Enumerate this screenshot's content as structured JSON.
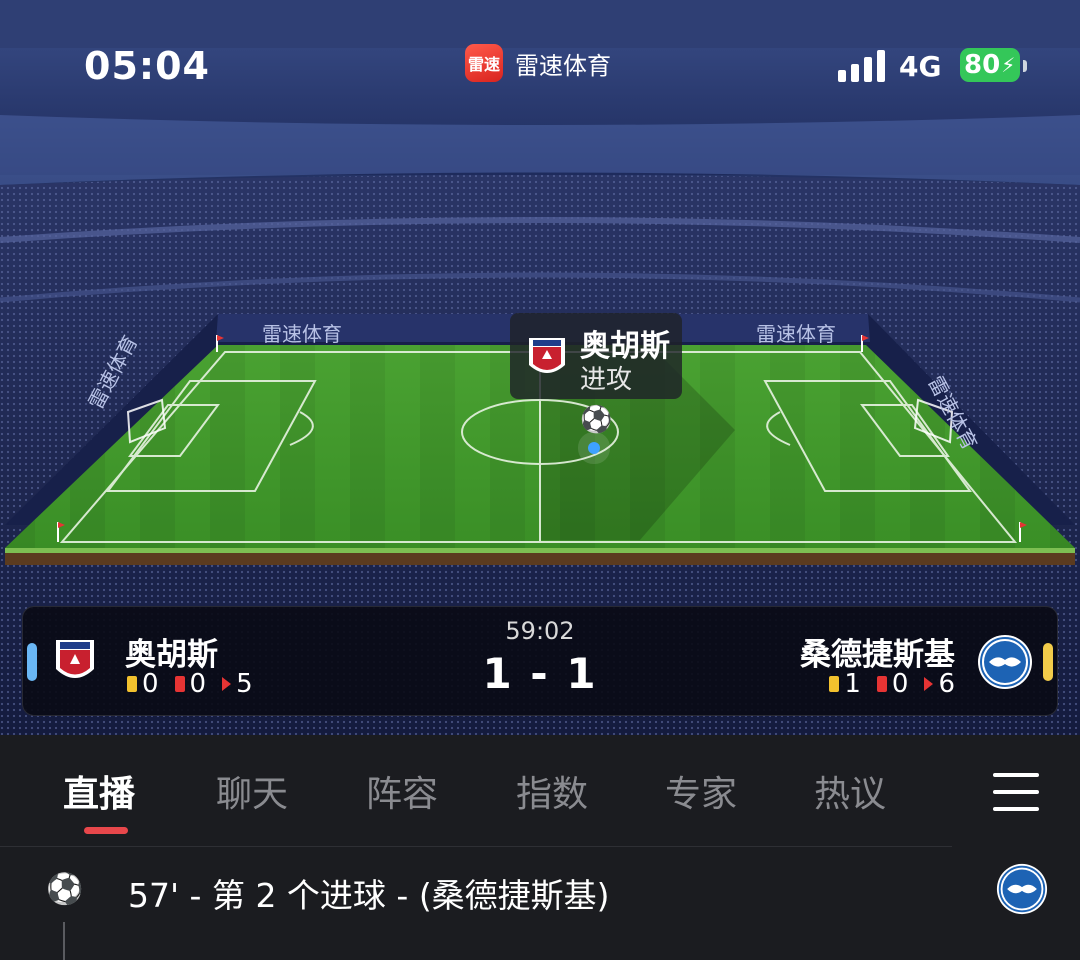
{
  "status_bar": {
    "time": "05:04",
    "app_logo_text": "雷速",
    "app_name": "雷速体育",
    "network": "4G",
    "battery": "80",
    "battery_color": "#34c759"
  },
  "pitch_ads": {
    "left": "雷速体育",
    "top_left": "雷速体育",
    "top_right": "雷速体育",
    "right": "雷速体育"
  },
  "event_popup": {
    "team": "奥胡斯",
    "action": "进攻",
    "badge_icon": "aarhus-crest-icon"
  },
  "scoreboard": {
    "clock": "59:02",
    "score": "1 - 1",
    "home": {
      "name": "奥胡斯",
      "yellow_cards": "0",
      "red_cards": "0",
      "corners": "5",
      "accent_color": "#6ab7f5"
    },
    "away": {
      "name": "桑德捷斯基",
      "yellow_cards": "1",
      "red_cards": "0",
      "corners": "6",
      "accent_color": "#f2cc4a"
    }
  },
  "tabs": [
    {
      "label": "直播",
      "active": true
    },
    {
      "label": "聊天"
    },
    {
      "label": "阵容"
    },
    {
      "label": "指数"
    },
    {
      "label": "专家"
    },
    {
      "label": "热议"
    }
  ],
  "feed": [
    {
      "icon": "soccer-ball-icon",
      "text": "57' - 第 2 个进球 - (桑德捷斯基)",
      "team_badge": "sonderjyske-crest-icon"
    }
  ],
  "colors": {
    "tab_indicator": "#e8474b",
    "pitch_green": "#3f9a2c",
    "background": "#1b1c20"
  }
}
